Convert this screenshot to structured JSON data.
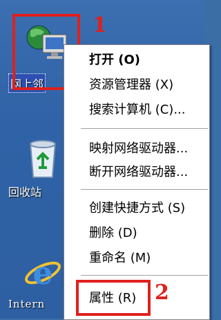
{
  "desktop": {
    "icons": [
      {
        "name": "network",
        "label": "网上邻"
      },
      {
        "name": "recycle",
        "label": "回收站"
      },
      {
        "name": "internet-explorer",
        "label": "Intern"
      }
    ]
  },
  "annotations": {
    "step1": "1",
    "step2": "2"
  },
  "context_menu": {
    "items": [
      {
        "label": "打开 (O)",
        "bold": true
      },
      {
        "label": "资源管理器 (X)"
      },
      {
        "label": "搜索计算机 (C)..."
      },
      {
        "label": "映射网络驱动器..."
      },
      {
        "label": "断开网络驱动器..."
      },
      {
        "label": "创建快捷方式 (S)"
      },
      {
        "label": "删除 (D)"
      },
      {
        "label": "重命名 (M)"
      },
      {
        "label": "属性 (R)"
      }
    ]
  },
  "colors": {
    "desktop": "#3b6fb0",
    "highlight": "#e0201c",
    "selection": "#2c4fb0"
  }
}
